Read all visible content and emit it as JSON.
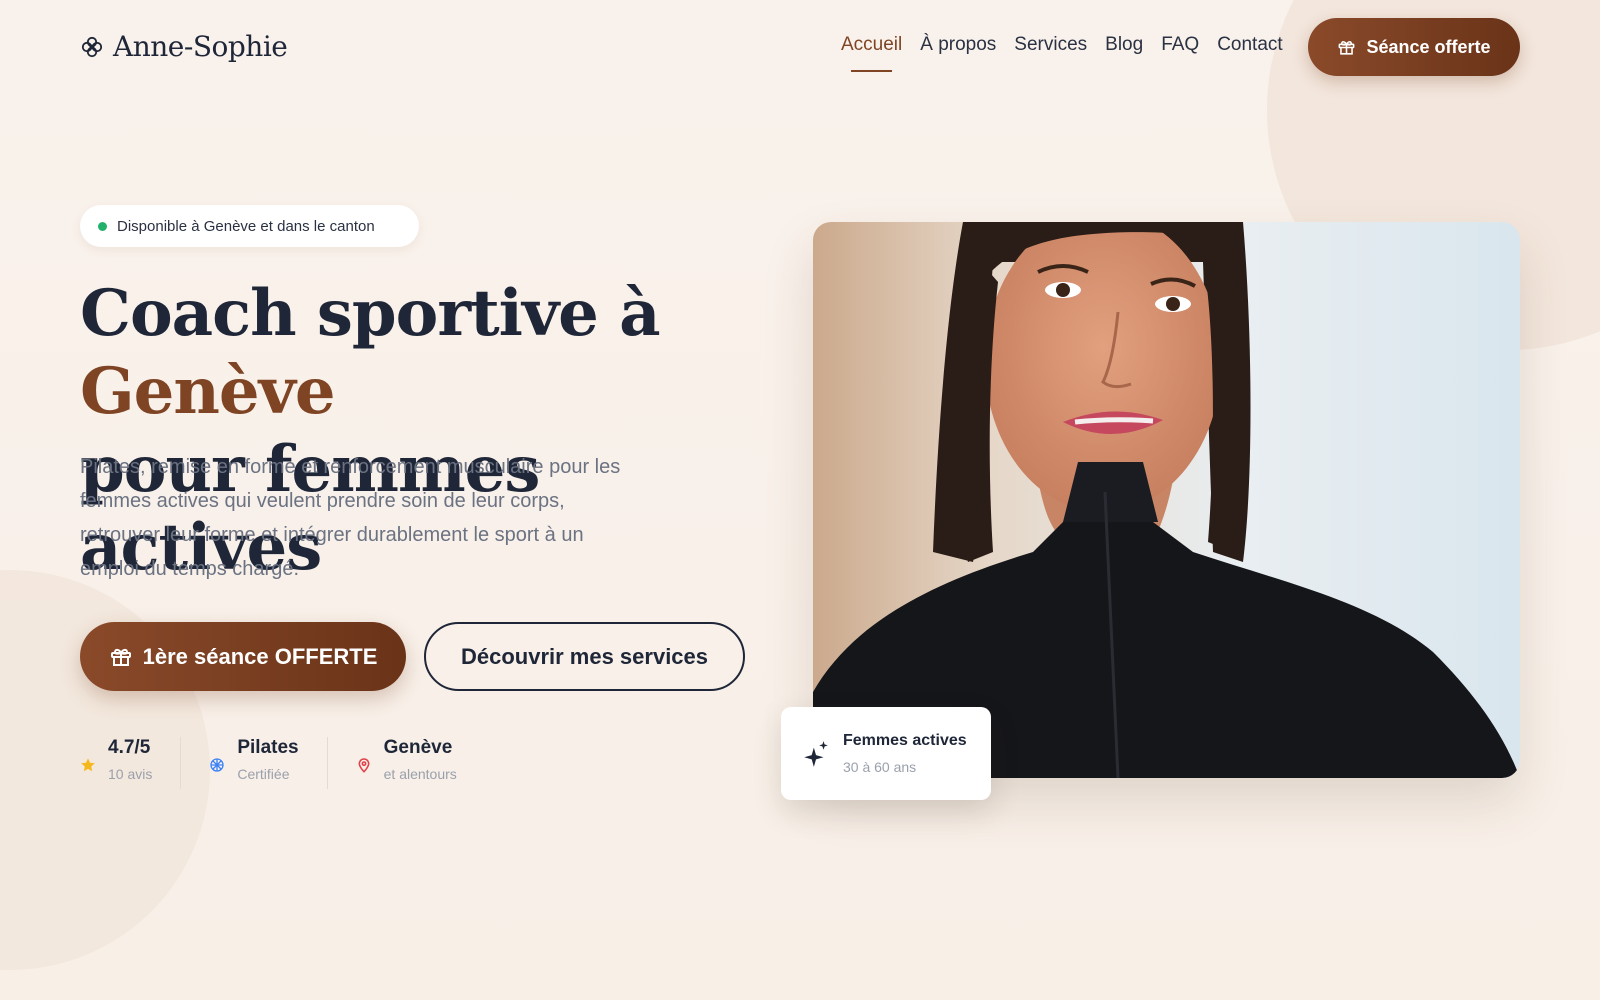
{
  "header": {
    "brand": "Anne-Sophie",
    "nav": [
      {
        "label": "Accueil",
        "active": true
      },
      {
        "label": "À propos",
        "active": false
      },
      {
        "label": "Services",
        "active": false
      },
      {
        "label": "Blog",
        "active": false
      },
      {
        "label": "FAQ",
        "active": false
      },
      {
        "label": "Contact",
        "active": false
      }
    ],
    "cta": "Séance offerte"
  },
  "hero": {
    "badge": "Disponible à Genève et dans le canton",
    "title_part1": "Coach sportive à ",
    "title_accent": "Genève",
    "title_part2": "pour femmes actives",
    "description": "Pilates, remise en forme et renforcement musculaire pour les femmes actives qui veulent prendre soin de leur corps, retrouver leur forme et intégrer durablement le sport à un emploi du temps chargé.",
    "primary_button": "1ère séance OFFERTE",
    "secondary_button": "Découvrir mes services"
  },
  "stats": [
    {
      "icon": "star-icon",
      "title": "4.7/5",
      "sub": "10 avis"
    },
    {
      "icon": "pilates-icon",
      "title": "Pilates",
      "sub": "Certifiée"
    },
    {
      "icon": "location-pin-icon",
      "title": "Genève",
      "sub": "et alentours"
    }
  ],
  "floating_card": {
    "icon": "sparkles-icon",
    "title": "Femmes actives",
    "sub": "30 à 60 ans"
  },
  "colors": {
    "accent": "#7f4424",
    "dark": "#1e2638",
    "background": "#f8f0e9",
    "status_dot": "#23b06a"
  }
}
